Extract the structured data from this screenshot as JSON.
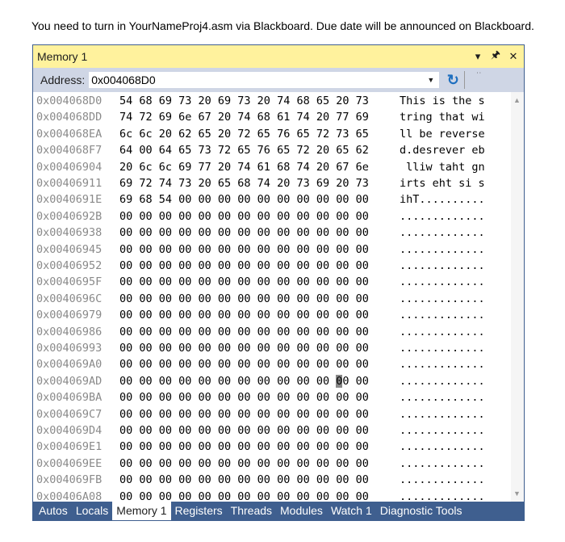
{
  "instruction": "You need to turn in YourNameProj4.asm via Blackboard. Due date will be announced on Blackboard.",
  "window": {
    "title": "Memory 1",
    "icons": [
      "dropdown-icon",
      "pin-icon",
      "close-icon"
    ]
  },
  "address_bar": {
    "label": "Address:",
    "value": "0x004068D0"
  },
  "cursor": {
    "row": 17,
    "byte": 11
  },
  "rows": [
    {
      "addr": "0x004068D0",
      "hex": "54 68 69 73 20 69 73 20 74 68 65 20 73",
      "ascii": "This is the s"
    },
    {
      "addr": "0x004068DD",
      "hex": "74 72 69 6e 67 20 74 68 61 74 20 77 69",
      "ascii": "tring that wi"
    },
    {
      "addr": "0x004068EA",
      "hex": "6c 6c 20 62 65 20 72 65 76 65 72 73 65",
      "ascii": "ll be reverse"
    },
    {
      "addr": "0x004068F7",
      "hex": "64 00 64 65 73 72 65 76 65 72 20 65 62",
      "ascii": "d.desrever eb"
    },
    {
      "addr": "0x00406904",
      "hex": "20 6c 6c 69 77 20 74 61 68 74 20 67 6e",
      "ascii": " lliw taht gn"
    },
    {
      "addr": "0x00406911",
      "hex": "69 72 74 73 20 65 68 74 20 73 69 20 73",
      "ascii": "irts eht si s"
    },
    {
      "addr": "0x0040691E",
      "hex": "69 68 54 00 00 00 00 00 00 00 00 00 00",
      "ascii": "ihT.........."
    },
    {
      "addr": "0x0040692B",
      "hex": "00 00 00 00 00 00 00 00 00 00 00 00 00",
      "ascii": "............."
    },
    {
      "addr": "0x00406938",
      "hex": "00 00 00 00 00 00 00 00 00 00 00 00 00",
      "ascii": "............."
    },
    {
      "addr": "0x00406945",
      "hex": "00 00 00 00 00 00 00 00 00 00 00 00 00",
      "ascii": "............."
    },
    {
      "addr": "0x00406952",
      "hex": "00 00 00 00 00 00 00 00 00 00 00 00 00",
      "ascii": "............."
    },
    {
      "addr": "0x0040695F",
      "hex": "00 00 00 00 00 00 00 00 00 00 00 00 00",
      "ascii": "............."
    },
    {
      "addr": "0x0040696C",
      "hex": "00 00 00 00 00 00 00 00 00 00 00 00 00",
      "ascii": "............."
    },
    {
      "addr": "0x00406979",
      "hex": "00 00 00 00 00 00 00 00 00 00 00 00 00",
      "ascii": "............."
    },
    {
      "addr": "0x00406986",
      "hex": "00 00 00 00 00 00 00 00 00 00 00 00 00",
      "ascii": "............."
    },
    {
      "addr": "0x00406993",
      "hex": "00 00 00 00 00 00 00 00 00 00 00 00 00",
      "ascii": "............."
    },
    {
      "addr": "0x004069A0",
      "hex": "00 00 00 00 00 00 00 00 00 00 00 00 00",
      "ascii": "............."
    },
    {
      "addr": "0x004069AD",
      "hex": "00 00 00 00 00 00 00 00 00 00 00 00 00",
      "ascii": "............."
    },
    {
      "addr": "0x004069BA",
      "hex": "00 00 00 00 00 00 00 00 00 00 00 00 00",
      "ascii": "............."
    },
    {
      "addr": "0x004069C7",
      "hex": "00 00 00 00 00 00 00 00 00 00 00 00 00",
      "ascii": "............."
    },
    {
      "addr": "0x004069D4",
      "hex": "00 00 00 00 00 00 00 00 00 00 00 00 00",
      "ascii": "............."
    },
    {
      "addr": "0x004069E1",
      "hex": "00 00 00 00 00 00 00 00 00 00 00 00 00",
      "ascii": "............."
    },
    {
      "addr": "0x004069EE",
      "hex": "00 00 00 00 00 00 00 00 00 00 00 00 00",
      "ascii": "............."
    },
    {
      "addr": "0x004069FB",
      "hex": "00 00 00 00 00 00 00 00 00 00 00 00 00",
      "ascii": "............."
    },
    {
      "addr": "0x00406A08",
      "hex": "00 00 00 00 00 00 00 00 00 00 00 00 00",
      "ascii": "............."
    }
  ],
  "tabs": [
    {
      "label": "Autos"
    },
    {
      "label": "Locals"
    },
    {
      "label": "Memory 1",
      "active": true
    },
    {
      "label": "Registers"
    },
    {
      "label": "Threads"
    },
    {
      "label": "Modules"
    },
    {
      "label": "Watch 1"
    },
    {
      "label": "Diagnostic Tools"
    }
  ]
}
